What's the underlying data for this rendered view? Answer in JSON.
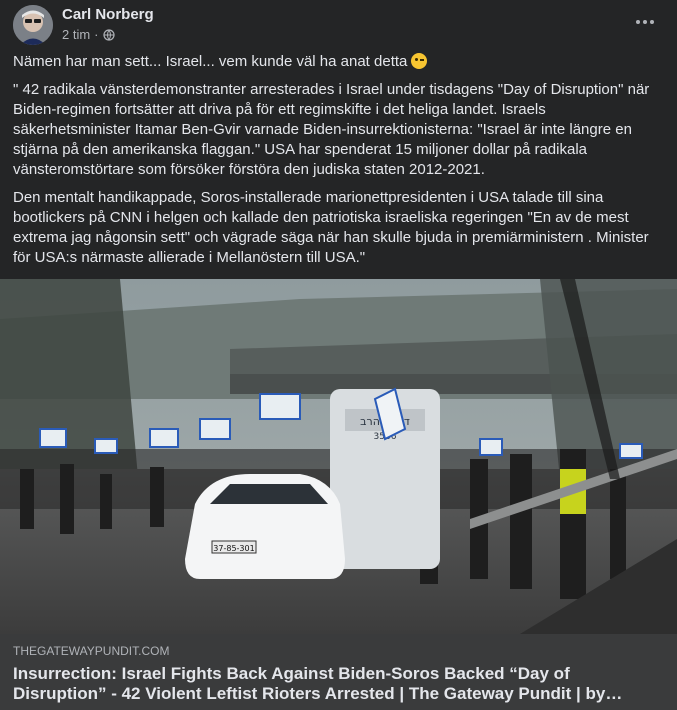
{
  "post": {
    "author": "Carl Norberg",
    "time": "2 tim",
    "separator": "·",
    "privacy_icon": "globe-icon",
    "menu_icon": "more-options-icon",
    "paragraph1": "Nämen har man sett... Israel... vem kunde väl ha anat detta",
    "emoji": "winking-face-emoji",
    "paragraph2": "\" 42 radikala vänsterdemonstranter arresterades i Israel under tisdagens \"Day of Disruption\" när Biden-regimen fortsätter att driva på för ett regimskifte i det heliga landet. Israels säkerhetsminister Itamar Ben-Gvir varnade Biden-insurrektionisterna: \"Israel är inte längre en stjärna på den amerikanska flaggan.\" USA har spenderat 15 miljoner dollar på radikala vänsteromstörtare som försöker förstöra den judiska staten 2012-2021.",
    "paragraph3": "Den mentalt handikappade, Soros-installerade marionettpresidenten i USA talade till sina bootlickers på CNN i helgen och kallade den patriotiska israeliska regeringen \"En av de mest extrema jag någonsin sett\" och vägrade säga när han skulle bjuda in premiärministern . Minister för USA:s närmaste allierade i Mellanöstern till USA.\""
  },
  "link": {
    "domain": "THEGATEWAYPUNDIT.COM",
    "title": "Insurrection: Israel Fights Back Against Biden-Soros Backed “Day of Disruption” - 42 Violent Leftist Rioters Arrested | The Gateway Pundit | by…",
    "van_sign": "דניאל הרב",
    "van_number": "3566",
    "plate": "37-85-301"
  },
  "colors": {
    "background": "#242526",
    "text": "#e4e6eb",
    "secondary": "#b0b3b8",
    "link_box": "#3a3b3c"
  }
}
